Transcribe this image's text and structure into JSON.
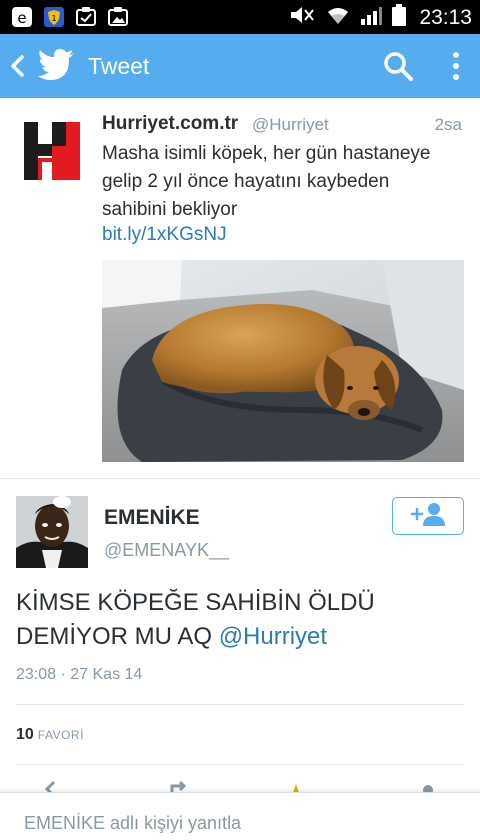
{
  "status_bar": {
    "time": "23:13",
    "icons": [
      "ie-icon",
      "shield-icon",
      "check-notification-icon",
      "image-notification-icon",
      "mute-icon",
      "wifi-icon",
      "signal-icon",
      "battery-icon"
    ]
  },
  "action_bar": {
    "title": "Tweet",
    "back_icon": "chevron-left-icon",
    "logo_icon": "twitter-bird-icon",
    "search_icon": "search-icon",
    "menu_icon": "more-vertical-icon",
    "color": "#55acee"
  },
  "quoted_tweet": {
    "name": "Hurriyet.com.tr",
    "handle": "@Hurriyet",
    "time": "2sa",
    "text": "Masha isimli köpek, her gün hastaneye gelip 2 yıl önce hayatını kaybeden sahibini bekliyor",
    "link": "bit.ly/1xKGsNJ",
    "avatar_letter": "H",
    "brand_color": "#e21b22"
  },
  "main_tweet": {
    "name": "EMENİKE",
    "handle": "@EMENAYK__",
    "text": "KİMSE KÖPEĞE  SAHİBİN ÖLDÜ DEMİYOR MU AQ ",
    "mention": "@Hurriyet",
    "meta": "23:08 · 27 Kas 14",
    "follow_icon": "add-user-icon"
  },
  "stats": {
    "favorites_count": "10",
    "favorites_label": "FAVORİ"
  },
  "actions": [
    "reply-icon",
    "retweet-icon",
    "favorite-icon",
    "share-icon"
  ],
  "reply_bar": {
    "placeholder": "EMENİKE  adlı kişiyi yanıtla"
  },
  "colors": {
    "link": "#2b7bb9",
    "text": "#292f33",
    "muted": "#8899a6"
  }
}
